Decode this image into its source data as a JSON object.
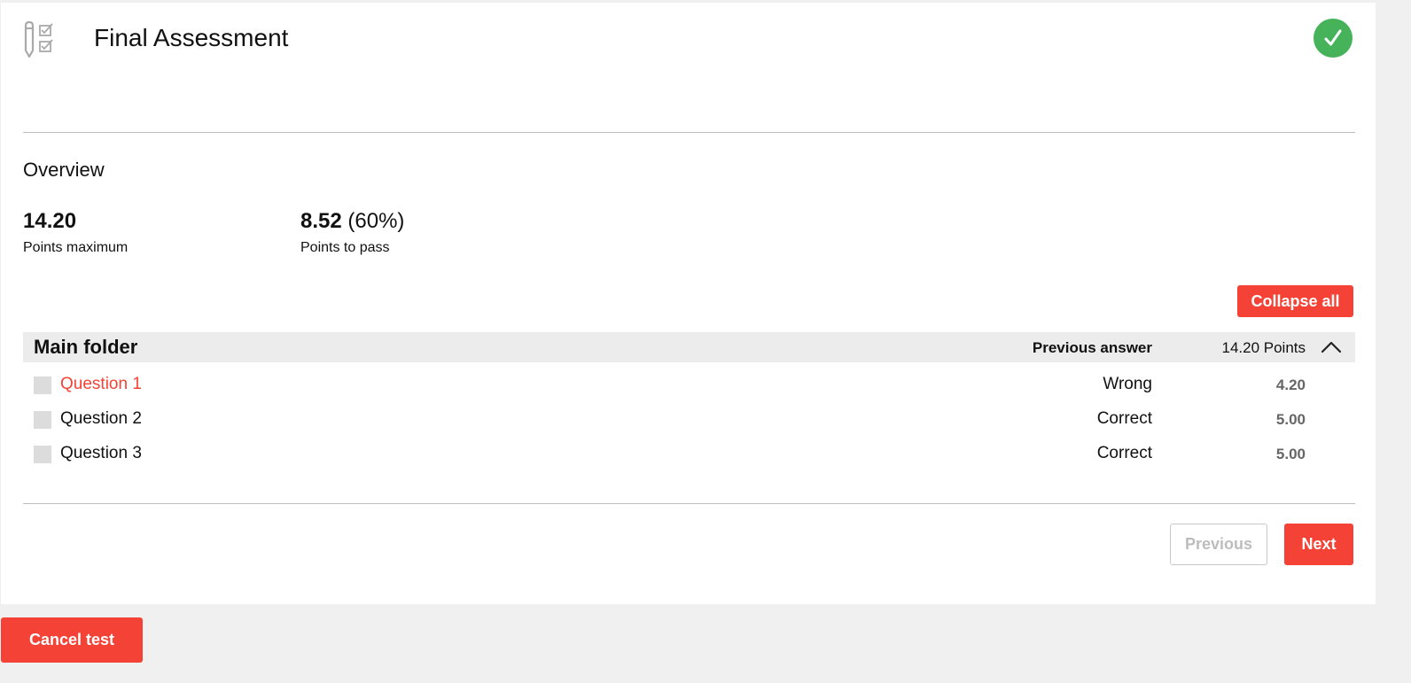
{
  "header": {
    "title": "Final Assessment",
    "icon": "test-checklist-icon",
    "status_icon": "check-icon",
    "status_color": "#46b35a"
  },
  "overview": {
    "title": "Overview",
    "points_maximum_value": "14.20",
    "points_maximum_label": "Points maximum",
    "points_to_pass_value": "8.52",
    "points_to_pass_percent": "(60%)",
    "points_to_pass_label": "Points to pass"
  },
  "actions": {
    "collapse_all": "Collapse all",
    "previous": "Previous",
    "next": "Next",
    "cancel_test": "Cancel test"
  },
  "folder": {
    "name": "Main folder",
    "previous_answer_header": "Previous answer",
    "points": "14.20 Points",
    "toggle_icon": "chevron-up-icon",
    "questions": [
      {
        "title": "Question 1",
        "result": "Wrong",
        "points": "4.20",
        "status": "wrong"
      },
      {
        "title": "Question 2",
        "result": "Correct",
        "points": "5.00",
        "status": "correct"
      },
      {
        "title": "Question 3",
        "result": "Correct",
        "points": "5.00",
        "status": "correct"
      }
    ]
  },
  "colors": {
    "accent": "#f44336",
    "success": "#46b35a",
    "background": "#f0f0f0",
    "folder_bar": "#ececec"
  }
}
